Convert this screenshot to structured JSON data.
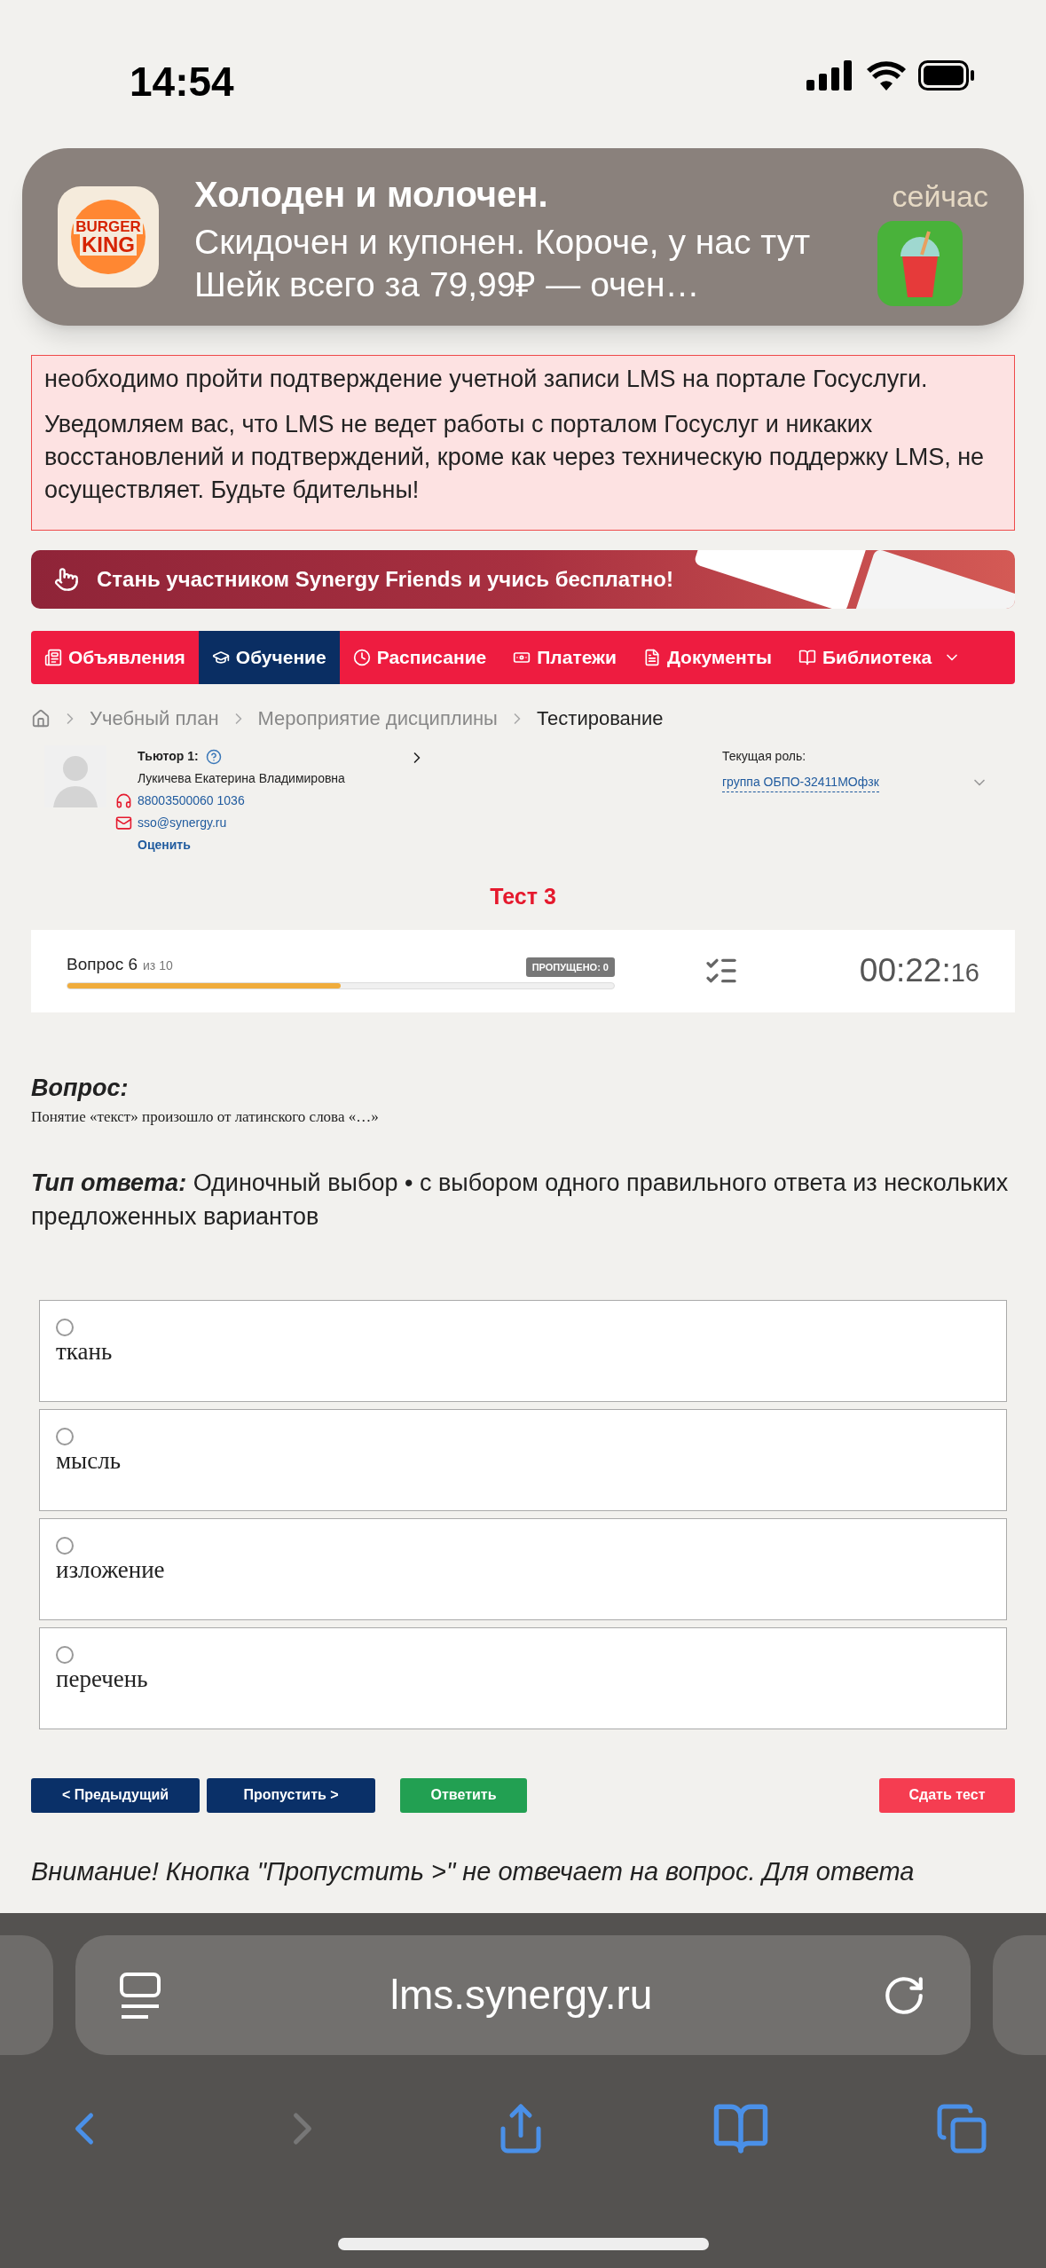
{
  "status_bar": {
    "time": "14:54"
  },
  "notification": {
    "app_logo_text": [
      "BURGER",
      "KING"
    ],
    "title": "Холоден и молочен.",
    "body": "Скидочен и купонен. Короче, у нас тут Шейк всего за 79,99₽ — очен…",
    "time": "сейчас"
  },
  "warning": {
    "paragraphs": [
      "необходимо пройти подтверждение учетной записи LMS на портале Госуслуги.",
      "Уведомляем вас, что LMS не ведет работы с порталом Госуслуг и никаких восстановлений и подтверждений, кроме как через техническую поддержку LMS, не осуществляет. Будьте бдительны!"
    ]
  },
  "banner": {
    "text": "Стань участником Synergy Friends и учись бесплатно!"
  },
  "nav": [
    {
      "kind": "news",
      "label": "Объявления",
      "selected": false
    },
    {
      "kind": "study",
      "label": "Обучение",
      "selected": true
    },
    {
      "kind": "schedule",
      "label": "Расписание",
      "selected": false
    },
    {
      "kind": "payments",
      "label": "Платежи",
      "selected": false
    },
    {
      "kind": "documents",
      "label": "Документы",
      "selected": false
    },
    {
      "kind": "library",
      "label": "Библиотека",
      "selected": false,
      "dropdown": true
    }
  ],
  "breadcrumb": [
    {
      "label": "Учебный план",
      "current": false
    },
    {
      "label": "Мероприятие дисциплины",
      "current": false
    },
    {
      "label": "Тестирование",
      "current": true
    }
  ],
  "tutor": {
    "heading": "Тьютор 1:",
    "name": "Лукичева Екатерина Владимировна",
    "phone": "88003500060 1036",
    "email": "sso@synergy.ru",
    "rate_link": "Оценить"
  },
  "role": {
    "label": "Текущая роль:",
    "value": "группа ОБПО-32411МОфзк"
  },
  "test": {
    "title": "Тест 3",
    "question_label": "Вопрос 6",
    "question_total": "из 10",
    "skipped_badge": "ПРОПУЩЕНО: 0",
    "level": 0.5,
    "timer_main": "00:22:",
    "timer_seconds": "16"
  },
  "question": {
    "label": "Вопрос:",
    "text": "Понятие «текст» произошло от латинского слова «…»",
    "answer_type_label": "Тип ответа:",
    "answer_type": "Одиночный выбор • с выбором одного правильного ответа из нескольких предложенных вариантов"
  },
  "options": [
    {
      "label": "ткань",
      "checked": false
    },
    {
      "label": "мысль",
      "checked": false
    },
    {
      "label": "изложение",
      "checked": false
    },
    {
      "label": "перечень",
      "checked": false
    }
  ],
  "buttons": [
    {
      "kind": "nav",
      "label": "< Предыдущий"
    },
    {
      "kind": "nav",
      "label": "Пропустить >"
    },
    {
      "kind": "answer",
      "label": "Ответить"
    },
    {
      "kind": "submit",
      "label": "Сдать тест"
    }
  ],
  "footer_note": "Внимание! Кнопка \"Пропустить >\" не отвечает на вопрос. Для ответа",
  "browser": {
    "url": "lms.synergy.ru"
  }
}
